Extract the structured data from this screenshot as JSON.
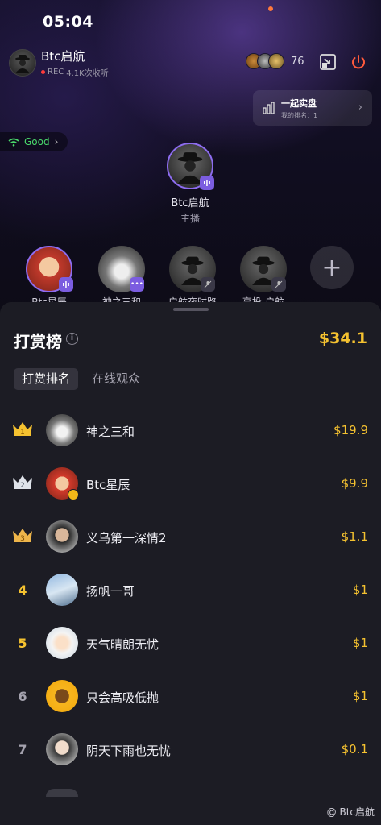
{
  "status_bar": {
    "time": "05:04"
  },
  "room": {
    "host_name": "Btc启航",
    "host_rec_label": "REC",
    "host_listeners": "4.1K次收听",
    "viewer_count": "76",
    "pk_card": {
      "title": "一起实盘",
      "subtitle": "我的排名：1"
    },
    "network_label": "Good",
    "host_seat": {
      "name": "Btc启航",
      "role": "主播"
    },
    "guests": [
      {
        "name": "Btc星辰"
      },
      {
        "name": "神之三和"
      },
      {
        "name": "启航夜时路"
      },
      {
        "name": "享投-启航"
      }
    ]
  },
  "sheet": {
    "title": "打赏榜",
    "total": "$34.1",
    "tabs": [
      "打赏排名",
      "在线观众"
    ],
    "rows": [
      {
        "rank": "1",
        "name": "神之三和",
        "amount": "$19.9"
      },
      {
        "rank": "2",
        "name": "Btc星辰",
        "amount": "$9.9"
      },
      {
        "rank": "3",
        "name": "义乌第一深情2",
        "amount": "$1.1"
      },
      {
        "rank": "4",
        "name": "扬帆一哥",
        "amount": "$1"
      },
      {
        "rank": "5",
        "name": "天气晴朗无忧",
        "amount": "$1"
      },
      {
        "rank": "6",
        "name": "只会高吸低抛",
        "amount": "$1"
      },
      {
        "rank": "7",
        "name": "阴天下雨也无忧",
        "amount": "$0.1"
      }
    ]
  },
  "watermark": "@ Btc启航",
  "colors": {
    "accent_gold": "#f5c230",
    "sheet_bg": "#1c1c24",
    "mic_purple": "#7b5de0",
    "good_green": "#49d86b"
  }
}
